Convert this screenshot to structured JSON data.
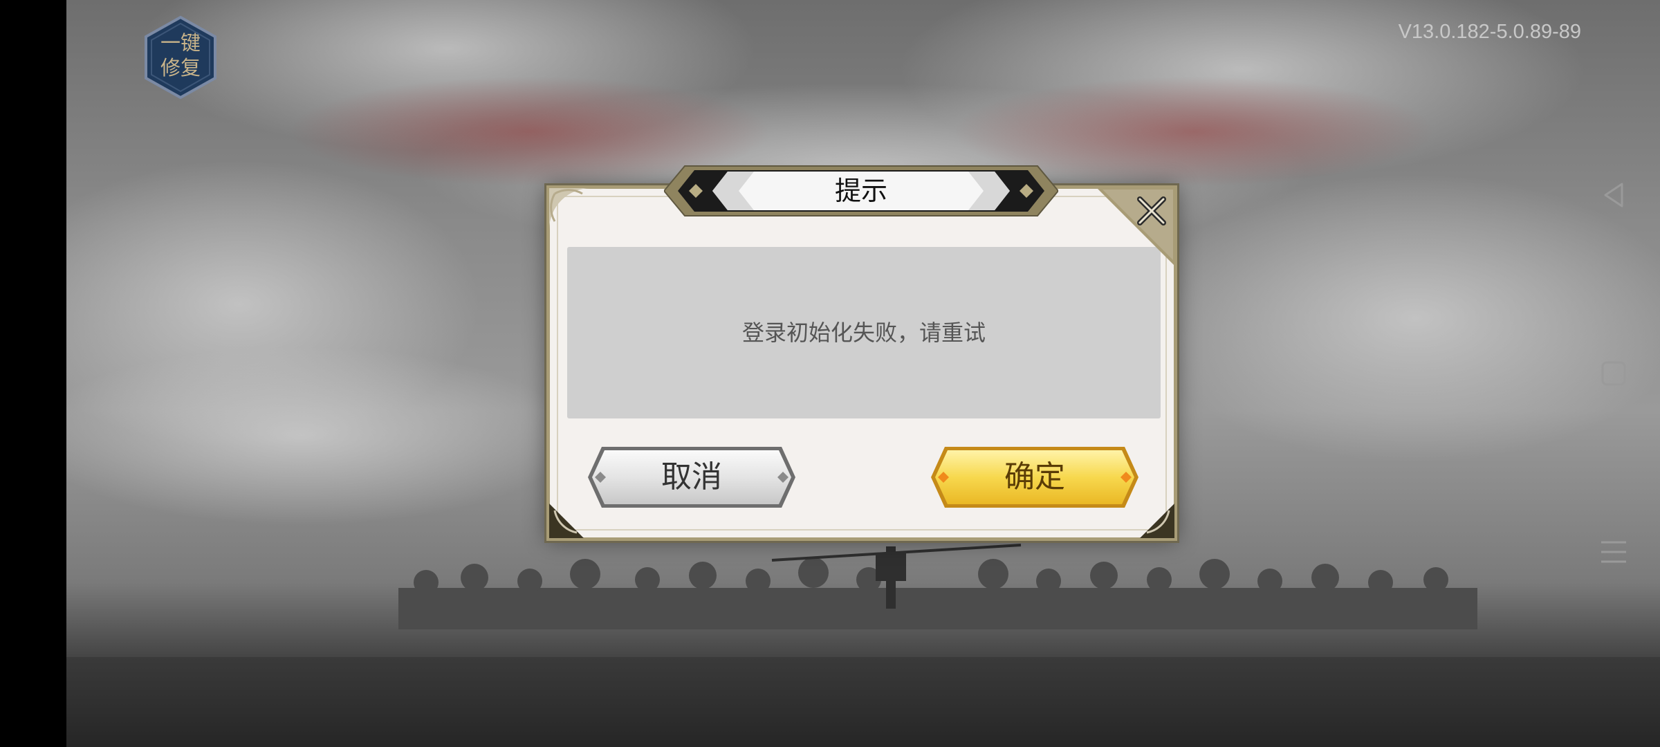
{
  "top": {
    "repair_label": "一键\n修复",
    "version": "V13.0.182-5.0.89-89"
  },
  "dialog": {
    "title": "提示",
    "message": "登录初始化失败，请重试",
    "cancel_label": "取消",
    "confirm_label": "确定"
  },
  "navbar": {
    "icons": [
      "back-icon",
      "home-icon",
      "menu-icon"
    ]
  },
  "colors": {
    "accent_gold": "#f2c93a",
    "frame": "#a89c76",
    "message_bg": "#cfcfcf"
  }
}
